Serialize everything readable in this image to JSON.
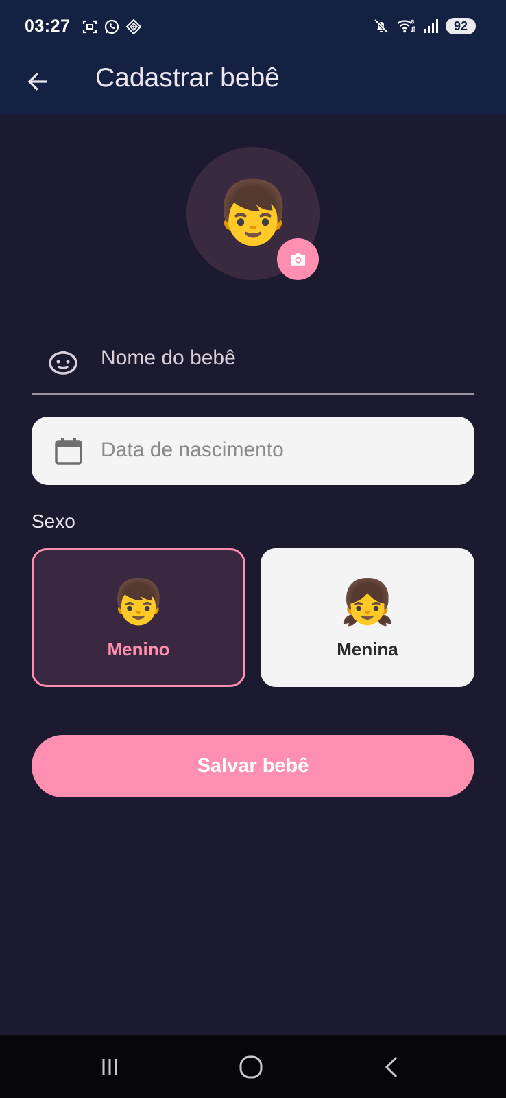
{
  "status_bar": {
    "time": "03:27",
    "battery": "92",
    "left_icons": [
      "screenshot-icon",
      "whatsapp-icon",
      "diamond-app-icon"
    ],
    "right_icons": [
      "mute-icon",
      "wifi-6-icon",
      "signal-icon"
    ]
  },
  "app_bar": {
    "title": "Cadastrar bebê",
    "back_icon": "arrow-back-icon"
  },
  "avatar": {
    "emoji": "👦",
    "camera_icon": "camera-icon"
  },
  "form": {
    "name_placeholder": "Nome do bebê",
    "date_placeholder": "Data de nascimento",
    "sex_label": "Sexo"
  },
  "sex_options": [
    {
      "emoji": "👦",
      "label": "Menino",
      "selected": true
    },
    {
      "emoji": "👧",
      "label": "Menina",
      "selected": false
    }
  ],
  "save_button": {
    "label": "Salvar bebê"
  },
  "colors": {
    "background": "#1b1a2e",
    "app_bar": "#152142",
    "accent": "#ff8fb0",
    "selected_card": "#3a2740",
    "card": "#f4f4f5"
  },
  "nav_bar": [
    "recents-icon",
    "home-icon",
    "back-icon"
  ]
}
